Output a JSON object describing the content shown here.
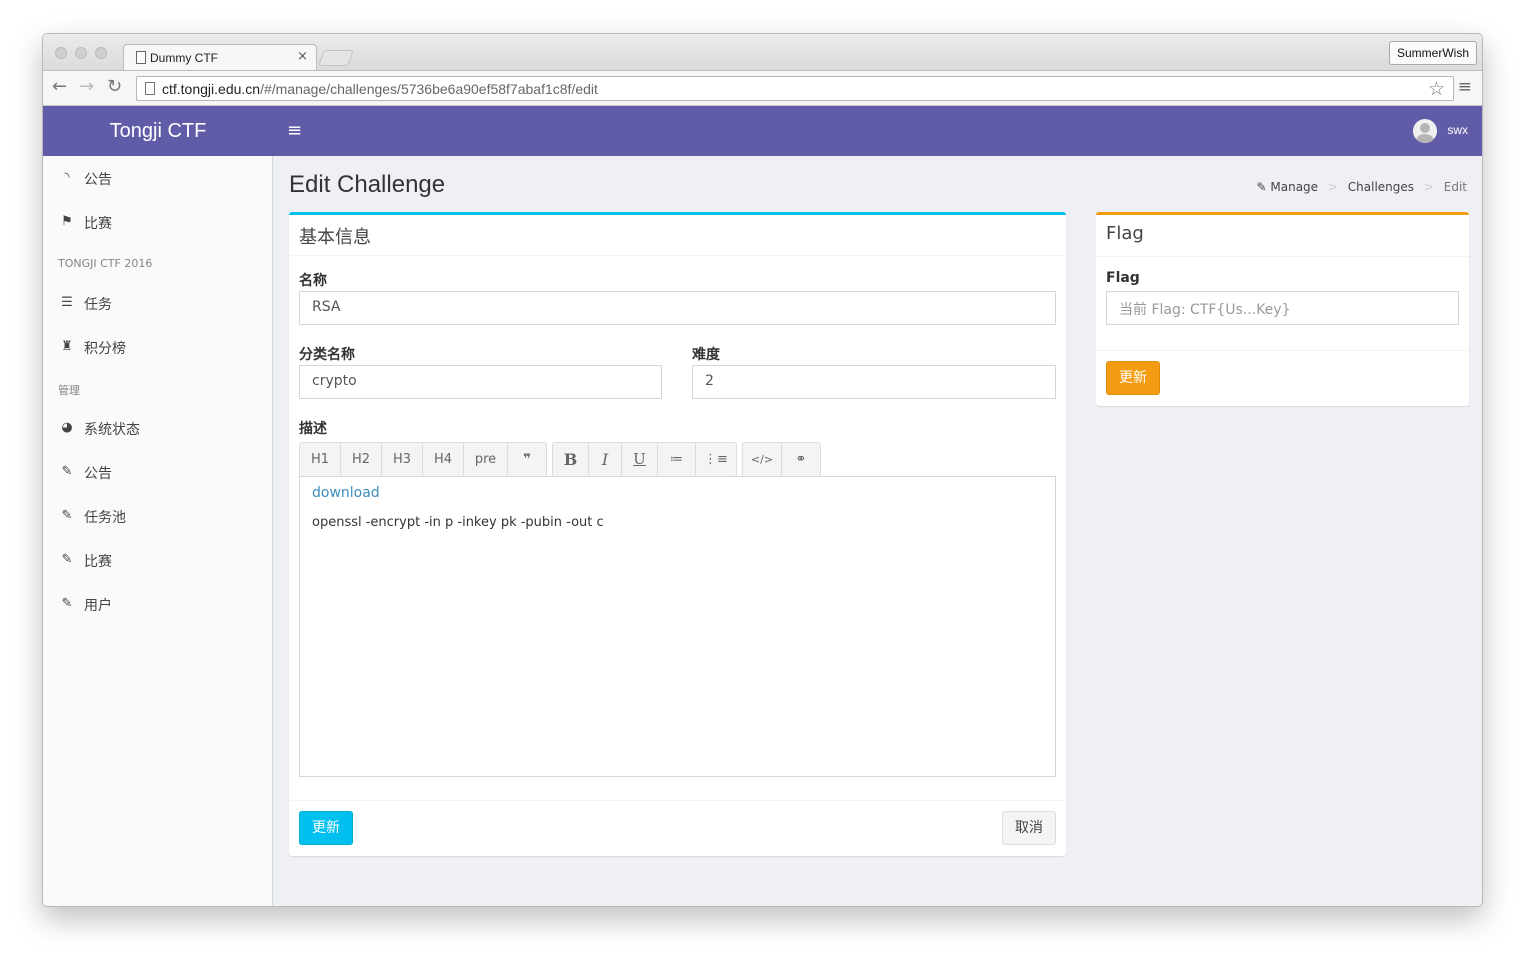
{
  "browser": {
    "tab_title": "Dummy CTF",
    "tab_close": "×",
    "profile": "SummerWish",
    "url_host": "ctf.tongji.edu.cn",
    "url_path": "/#/manage/challenges/5736be6a90ef58f7abaf1c8f/edit"
  },
  "app": {
    "brand": "Tongji CTF",
    "username": "swx"
  },
  "sidebar": {
    "top_items": [
      {
        "label": "公告",
        "icon": "rss-icon"
      },
      {
        "label": "比赛",
        "icon": "flag-icon"
      }
    ],
    "section1": "TONGJI CTF 2016",
    "section1_items": [
      {
        "label": "任务",
        "icon": "list-icon"
      },
      {
        "label": "积分榜",
        "icon": "trophy-icon"
      }
    ],
    "section2": "管理",
    "section2_items": [
      {
        "label": "系统状态",
        "icon": "dashboard-icon"
      },
      {
        "label": "公告",
        "icon": "wrench-icon"
      },
      {
        "label": "任务池",
        "icon": "wrench-icon"
      },
      {
        "label": "比赛",
        "icon": "wrench-icon"
      },
      {
        "label": "用户",
        "icon": "wrench-icon"
      }
    ]
  },
  "page": {
    "title": "Edit Challenge",
    "breadcrumb": [
      "Manage",
      "Challenges",
      "Edit"
    ]
  },
  "basic_box": {
    "title": "基本信息",
    "name_label": "名称",
    "name_value": "RSA",
    "category_label": "分类名称",
    "category_value": "crypto",
    "difficulty_label": "难度",
    "difficulty_value": "2",
    "desc_label": "描述",
    "toolbar": {
      "headings": [
        "H1",
        "H2",
        "H3",
        "H4",
        "pre",
        "❞"
      ],
      "format": [
        "B",
        "I",
        "U",
        "≔",
        "⋮≡"
      ],
      "extra": [
        "</>",
        "⚭"
      ]
    },
    "desc_link": "download",
    "desc_text": "openssl -encrypt -in p -inkey pk -pubin -out c",
    "update_label": "更新",
    "cancel_label": "取消"
  },
  "flag_box": {
    "title": "Flag",
    "flag_label": "Flag",
    "flag_placeholder": "当前 Flag: CTF{Us...Key}",
    "update_label": "更新"
  },
  "colors": {
    "appbar": "#605ca8",
    "info": "#00c0ef",
    "warning": "#f39c12"
  }
}
